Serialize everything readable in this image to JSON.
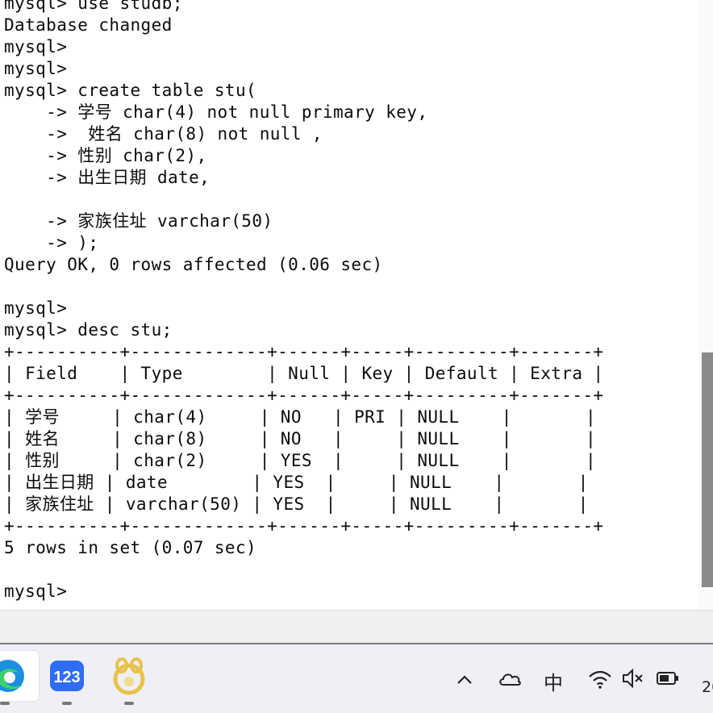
{
  "terminal": {
    "lines": [
      "mysql> use studb;",
      "Database changed",
      "mysql>",
      "mysql>",
      "mysql> create table stu(",
      "    -> 学号 char(4) not null primary key,",
      "    ->  姓名 char(8) not null ,",
      "    -> 性别 char(2),",
      "    -> 出生日期 date,",
      "",
      "    -> 家族住址 varchar(50)",
      "    -> );",
      "Query OK, 0 rows affected (0.06 sec)",
      "",
      "mysql>",
      "mysql> desc stu;",
      "+----------+-------------+------+-----+---------+-------+",
      "| Field    | Type        | Null | Key | Default | Extra |",
      "+----------+-------------+------+-----+---------+-------+",
      "| 学号     | char(4)     | NO   | PRI | NULL    |       |",
      "| 姓名     | char(8)     | NO   |     | NULL    |       |",
      "| 性别     | char(2)     | YES  |     | NULL    |       |",
      "| 出生日期 | date        | YES  |     | NULL    |       |",
      "| 家族住址 | varchar(50) | YES  |     | NULL    |       |",
      "+----------+-------------+------+-----+---------+-------+",
      "5 rows in set (0.07 sec)",
      "",
      "mysql>"
    ]
  },
  "taskbar": {
    "apps": [
      {
        "icon": "edge-browser-icon",
        "color": "#1b8fe0"
      },
      {
        "icon": "123-app-icon",
        "label": "123",
        "color": "#2f6df6"
      },
      {
        "icon": "navicat-icon",
        "color": "#e8c24a"
      }
    ],
    "tray": {
      "ime_label": "中",
      "clock_partial": "20"
    }
  }
}
